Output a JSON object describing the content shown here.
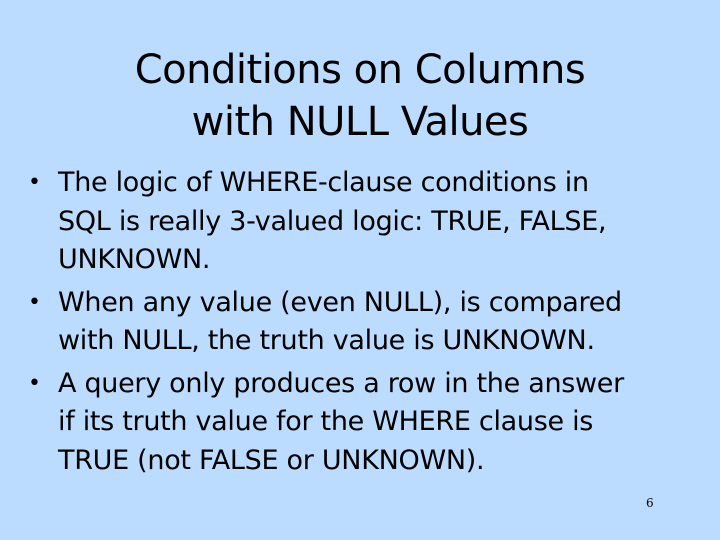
{
  "slide": {
    "title": [
      "Conditions on Columns",
      "with NULL Values"
    ],
    "bullet_glyph": "•",
    "bullets": [
      {
        "lines": [
          "The logic of WHERE-clause conditions in",
          "SQL is really 3-valued logic: TRUE, FALSE,",
          "UNKNOWN."
        ]
      },
      {
        "lines": [
          "When any value (even NULL), is compared",
          "with NULL, the truth value is UNKNOWN."
        ]
      },
      {
        "lines": [
          "A query only produces a row in the answer",
          "if its truth value for the WHERE clause is",
          "TRUE (not FALSE or UNKNOWN)."
        ]
      }
    ],
    "page_number": "6",
    "colors": {
      "background": "#bcdcff",
      "text": "#000000"
    }
  }
}
